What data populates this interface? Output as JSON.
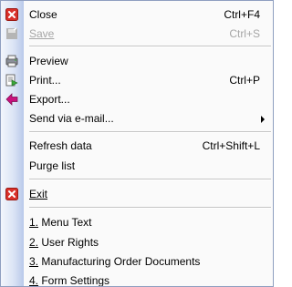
{
  "menu": {
    "close": {
      "label": "Close",
      "shortcut": "Ctrl+F4",
      "icon": "close-x-icon"
    },
    "save": {
      "label": "Save",
      "shortcut": "Ctrl+S",
      "icon": "save-icon",
      "disabled": true
    },
    "preview": {
      "label": "Preview",
      "icon": "preview-icon"
    },
    "print": {
      "label": "Print...",
      "shortcut": "Ctrl+P",
      "icon": "print-icon"
    },
    "export": {
      "label": "Export...",
      "icon": "export-arrow-icon"
    },
    "send_email": {
      "label": "Send via e-mail...",
      "has_submenu": true
    },
    "refresh": {
      "label": "Refresh data",
      "shortcut": "Ctrl+Shift+L"
    },
    "purge": {
      "label": "Purge list"
    },
    "exit": {
      "label": "Exit",
      "icon": "exit-x-icon"
    },
    "recent": [
      {
        "num": "1.",
        "label": " Menu Text"
      },
      {
        "num": "2.",
        "label": " User Rights"
      },
      {
        "num": "3.",
        "label": " Manufacturing Order Documents"
      },
      {
        "num": "4.",
        "label": " Form Settings"
      }
    ]
  },
  "colors": {
    "close_icon_red": "#d9302a",
    "disabled_text": "#a6a6a6",
    "export_magenta": "#c8117d",
    "print_green": "#3aa63a"
  }
}
